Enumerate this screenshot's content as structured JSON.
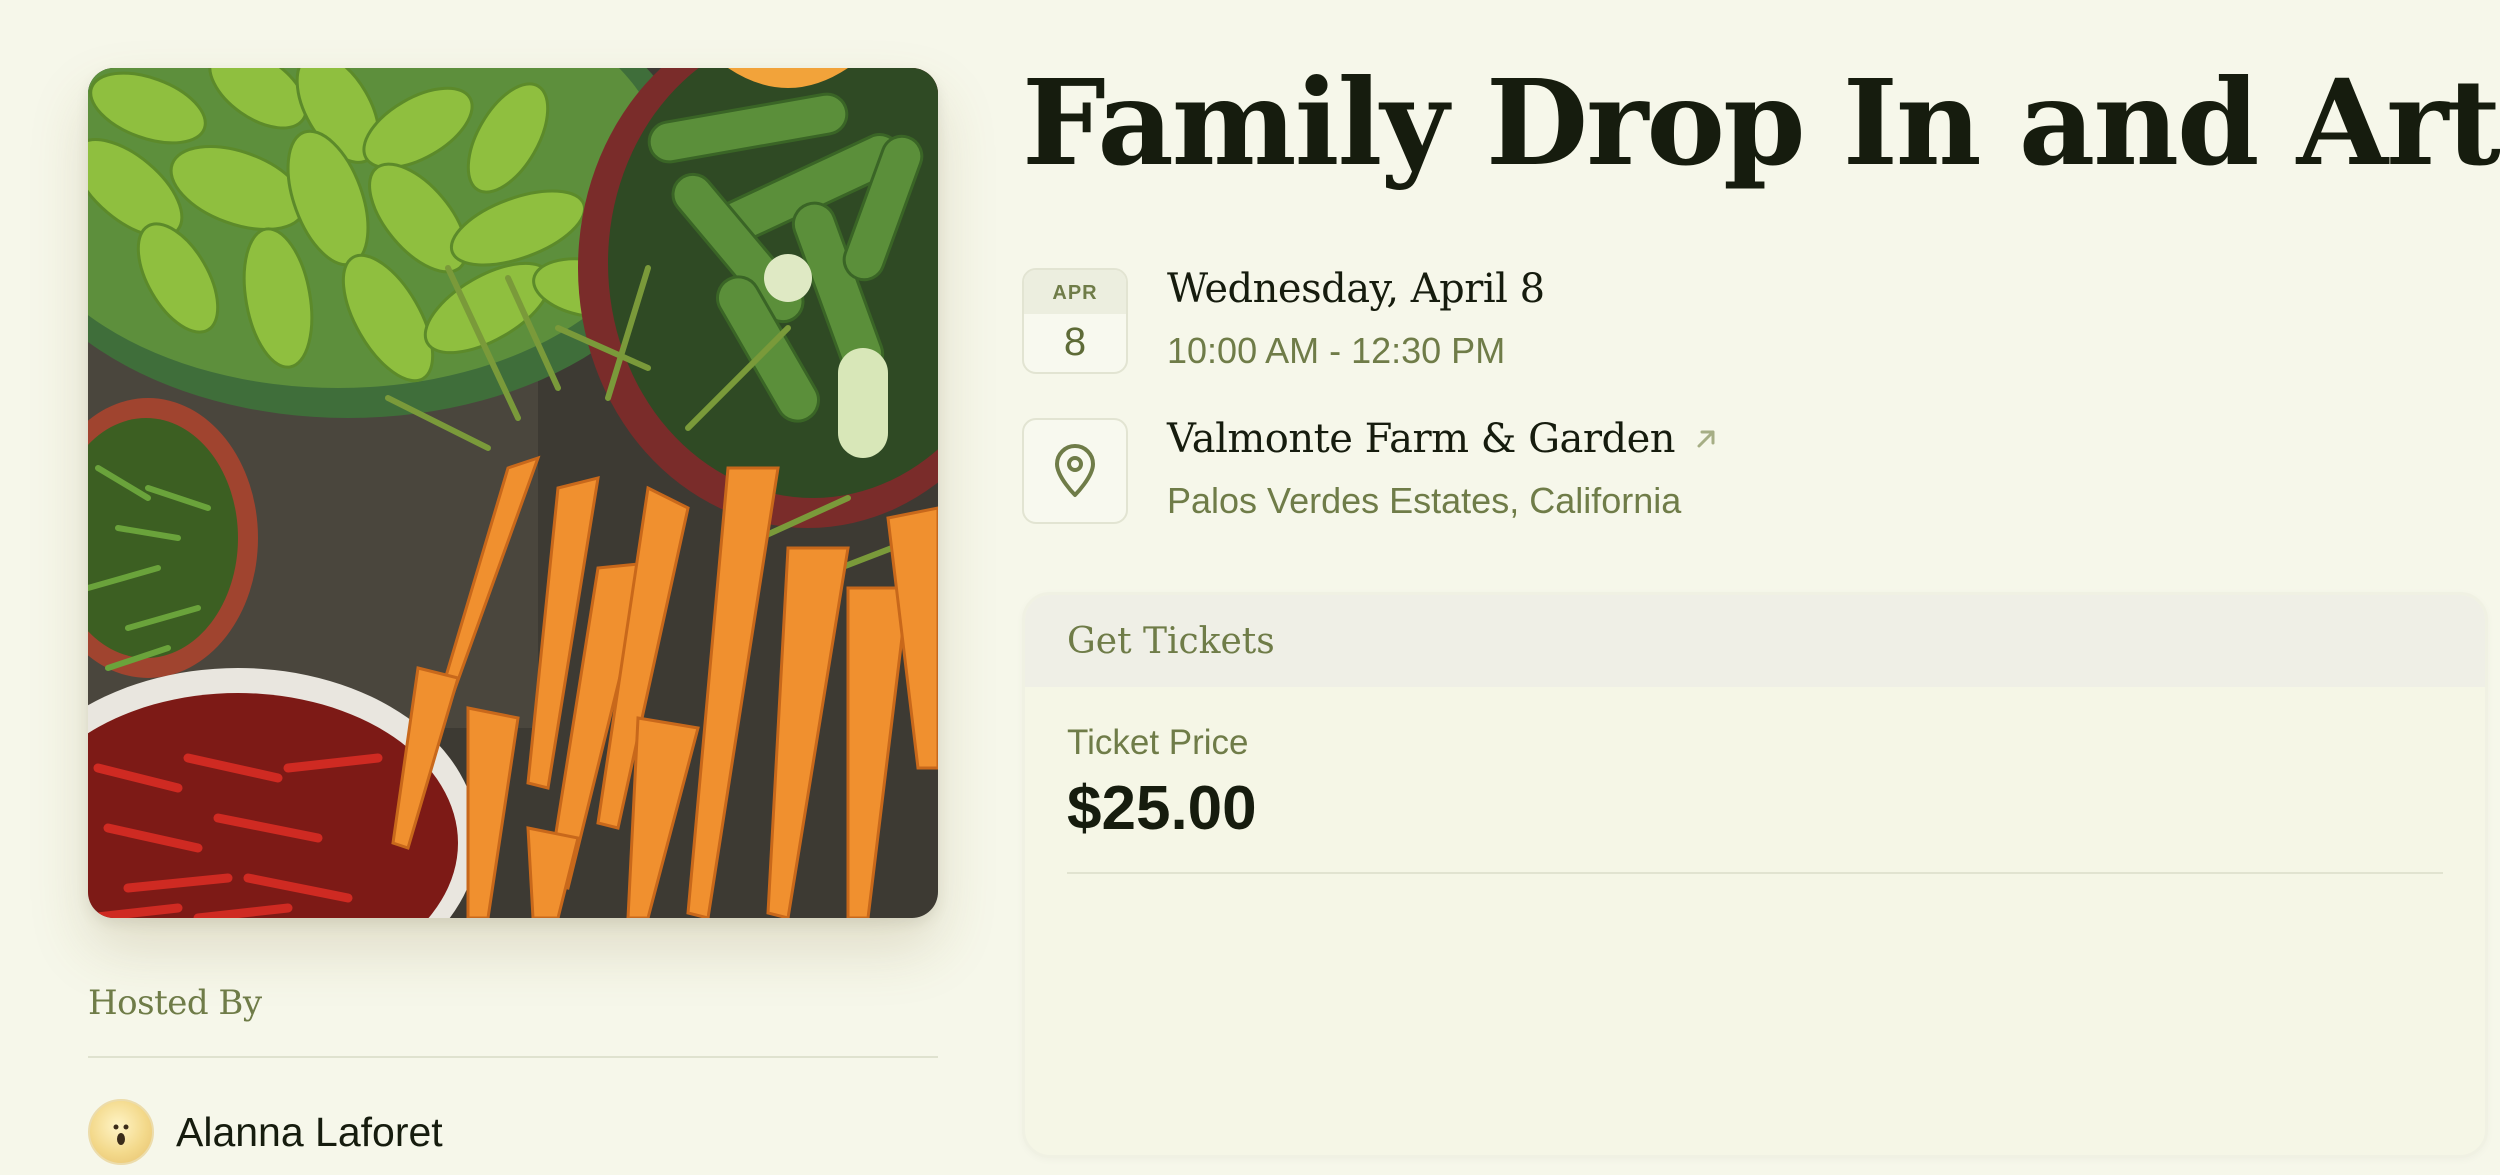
{
  "event": {
    "title": "Family Drop In and Art",
    "date": {
      "month": "APR",
      "day": "8",
      "full": "Wednesday, April 8",
      "time": "10:00 AM - 12:30 PM"
    },
    "location": {
      "name": "Valmonte Farm & Garden",
      "address": "Palos Verdes Estates, California"
    }
  },
  "host": {
    "label": "Hosted By",
    "name": "Alanna Laforet"
  },
  "tickets": {
    "header": "Get Tickets",
    "price_label": "Ticket Price",
    "price": "$25.00"
  },
  "icons": {
    "location": "map-pin-icon",
    "external": "arrow-up-right-icon"
  },
  "colors": {
    "background": "#f6f7ea",
    "accent_olive": "#6f7c48",
    "text_dark": "#161c0e",
    "card_header": "#efefe6"
  }
}
